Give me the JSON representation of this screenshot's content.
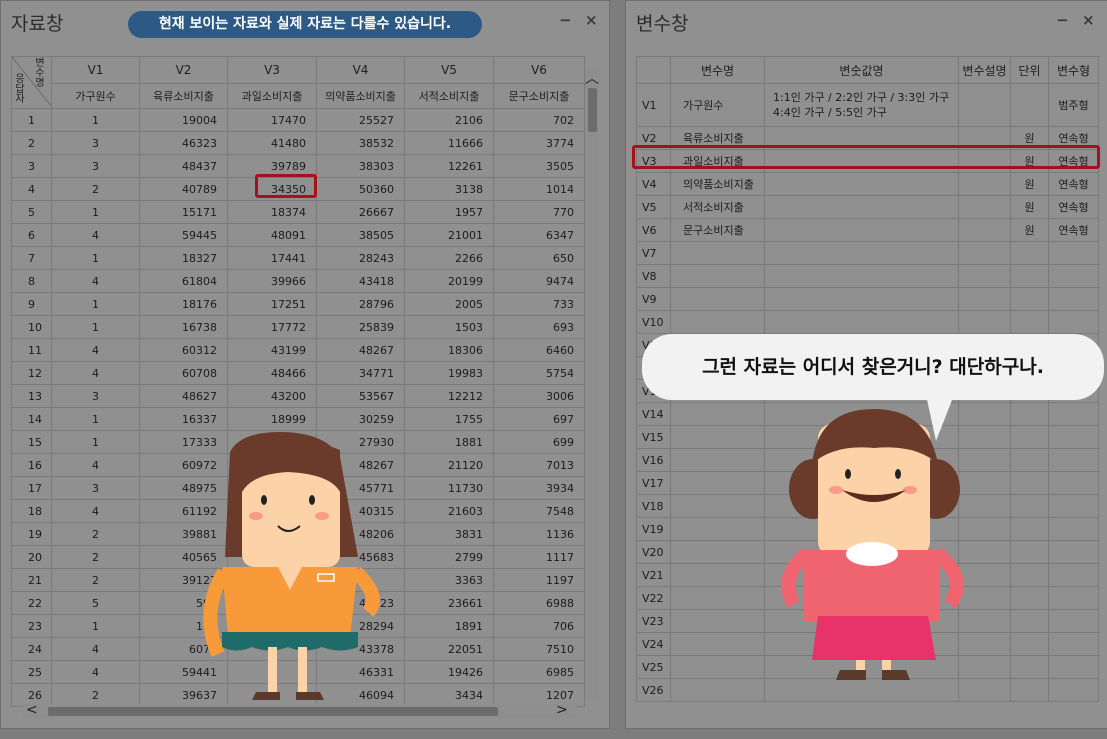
{
  "data_window": {
    "title": "자료창",
    "notice": "현재 보이는 자료와 실제 자료는 다를수 있습니다.",
    "minimize": "−",
    "close": "×",
    "corner_top": "변수명",
    "corner_bottom": "응답자",
    "columns": [
      {
        "code": "V1",
        "label": "가구원수"
      },
      {
        "code": "V2",
        "label": "육류소비지출"
      },
      {
        "code": "V3",
        "label": "과일소비지출"
      },
      {
        "code": "V4",
        "label": "의약품소비지출"
      },
      {
        "code": "V5",
        "label": "서적소비지출"
      },
      {
        "code": "V6",
        "label": "문구소비지출"
      }
    ],
    "rows": [
      [
        "1",
        "1",
        "19004",
        "17470",
        "25527",
        "2106",
        "702"
      ],
      [
        "2",
        "3",
        "46323",
        "41480",
        "38532",
        "11666",
        "3774"
      ],
      [
        "3",
        "3",
        "48437",
        "39789",
        "38303",
        "12261",
        "3505"
      ],
      [
        "4",
        "2",
        "40789",
        "34350",
        "50360",
        "3138",
        "1014"
      ],
      [
        "5",
        "1",
        "15171",
        "18374",
        "26667",
        "1957",
        "770"
      ],
      [
        "6",
        "4",
        "59445",
        "48091",
        "38505",
        "21001",
        "6347"
      ],
      [
        "7",
        "1",
        "18327",
        "17441",
        "28243",
        "2266",
        "650"
      ],
      [
        "8",
        "4",
        "61804",
        "39966",
        "43418",
        "20199",
        "9474"
      ],
      [
        "9",
        "1",
        "18176",
        "17251",
        "28796",
        "2005",
        "733"
      ],
      [
        "10",
        "1",
        "16738",
        "17772",
        "25839",
        "1503",
        "693"
      ],
      [
        "11",
        "4",
        "60312",
        "43199",
        "48267",
        "18306",
        "6460"
      ],
      [
        "12",
        "4",
        "60708",
        "48466",
        "34771",
        "19983",
        "5754"
      ],
      [
        "13",
        "3",
        "48627",
        "43200",
        "53567",
        "12212",
        "3006"
      ],
      [
        "14",
        "1",
        "16337",
        "18999",
        "30259",
        "1755",
        "697"
      ],
      [
        "15",
        "1",
        "17333",
        "",
        "27930",
        "1881",
        "699"
      ],
      [
        "16",
        "4",
        "60972",
        "",
        "48267",
        "21120",
        "7013"
      ],
      [
        "17",
        "3",
        "48975",
        "",
        "45771",
        "11730",
        "3934"
      ],
      [
        "18",
        "4",
        "61192",
        "",
        "40315",
        "21603",
        "7548"
      ],
      [
        "19",
        "2",
        "39881",
        "",
        "48206",
        "3831",
        "1136"
      ],
      [
        "20",
        "2",
        "40565",
        "",
        "45683",
        "2799",
        "1117"
      ],
      [
        "21",
        "2",
        "39127",
        "",
        "",
        "3363",
        "1197"
      ],
      [
        "22",
        "5",
        "592",
        "",
        "48123",
        "23661",
        "6988"
      ],
      [
        "23",
        "1",
        "176",
        "",
        "28294",
        "1891",
        "706"
      ],
      [
        "24",
        "4",
        "6078",
        "",
        "43378",
        "22051",
        "7510"
      ],
      [
        "25",
        "4",
        "59441",
        "",
        "46331",
        "19426",
        "6985"
      ],
      [
        "26",
        "2",
        "39637",
        "",
        "46094",
        "3434",
        "1207"
      ]
    ]
  },
  "var_window": {
    "title": "변수창",
    "minimize": "−",
    "close": "×",
    "headers": [
      "",
      "변수명",
      "변숫값명",
      "변수설명",
      "단위",
      "변수형"
    ],
    "rows": [
      {
        "id": "V1",
        "name": "가구원수",
        "values": "1:1인 가구 / 2:2인 가구 / 3:3인 가구",
        "values2": "4:4인 가구 / 5:5인 가구",
        "desc": "",
        "unit": "",
        "type": "범주형"
      },
      {
        "id": "V2",
        "name": "육류소비지출",
        "values": "",
        "values2": "",
        "desc": "",
        "unit": "원",
        "type": "연속형"
      },
      {
        "id": "V3",
        "name": "과일소비지출",
        "values": "",
        "values2": "",
        "desc": "",
        "unit": "원",
        "type": "연속형"
      },
      {
        "id": "V4",
        "name": "의약품소비지출",
        "values": "",
        "values2": "",
        "desc": "",
        "unit": "원",
        "type": "연속형"
      },
      {
        "id": "V5",
        "name": "서적소비지출",
        "values": "",
        "values2": "",
        "desc": "",
        "unit": "원",
        "type": "연속형"
      },
      {
        "id": "V6",
        "name": "문구소비지출",
        "values": "",
        "values2": "",
        "desc": "",
        "unit": "원",
        "type": "연속형"
      },
      {
        "id": "V7"
      },
      {
        "id": "V8"
      },
      {
        "id": "V9"
      },
      {
        "id": "V10"
      },
      {
        "id": "V11"
      },
      {
        "id": "V12"
      },
      {
        "id": "V13"
      },
      {
        "id": "V14"
      },
      {
        "id": "V15"
      },
      {
        "id": "V16"
      },
      {
        "id": "V17"
      },
      {
        "id": "V18"
      },
      {
        "id": "V19"
      },
      {
        "id": "V20"
      },
      {
        "id": "V21"
      },
      {
        "id": "V22"
      },
      {
        "id": "V23"
      },
      {
        "id": "V24"
      },
      {
        "id": "V25"
      },
      {
        "id": "V26"
      }
    ]
  },
  "speech_bubble": "그런 자료는 어디서 찾은거니? 대단하구나.",
  "colors": {
    "highlight": "#a3121b",
    "notice_bg": "#2c5a84",
    "girl_shirt": "#f89a3a",
    "girl_skirt": "#1f6b6a",
    "woman_shirt": "#f06470",
    "woman_skirt": "#e8336a",
    "hair": "#6a3b2a",
    "skin": "#fcd3a8"
  }
}
